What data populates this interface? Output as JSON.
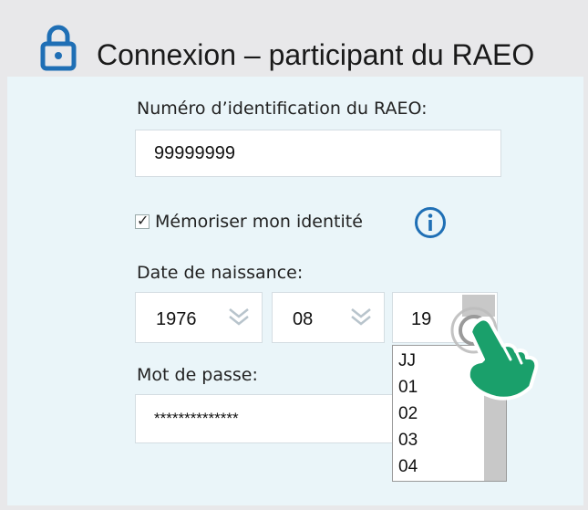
{
  "header": {
    "title": "Connexion – participant du RAEO",
    "icon": "lock-icon",
    "accent_color": "#1f6fb5"
  },
  "form": {
    "id_label": "Numéro d’identification du RAEO:",
    "id_value": "99999999",
    "remember_label": "Mémoriser mon identité",
    "remember_checked": true,
    "info_icon": "info-icon",
    "dob_label": "Date de naissance:",
    "dob_year": "1976",
    "dob_month": "08",
    "dob_day": "19",
    "password_label": "Mot de passe:",
    "password_value": "**************"
  },
  "day_dropdown": {
    "options": [
      "JJ",
      "01",
      "02",
      "03",
      "04"
    ]
  },
  "pointer": {
    "icon": "hand-pointer-icon",
    "color": "#1aa06b"
  },
  "colors": {
    "panel_bg": "#eaf5f9",
    "header_bg": "#e8e8ea"
  }
}
